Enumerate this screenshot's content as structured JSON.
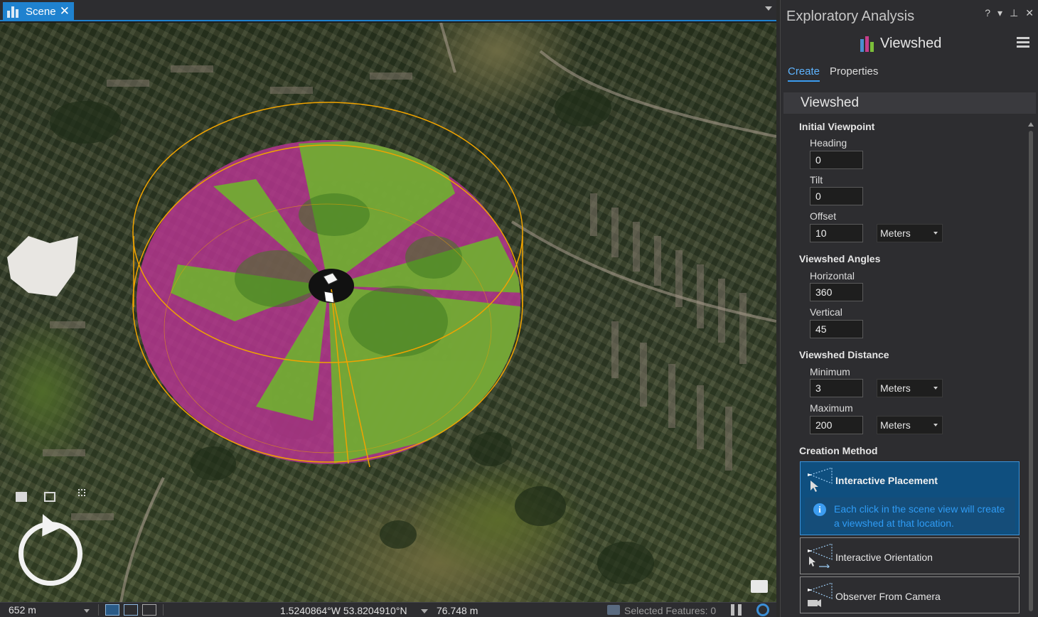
{
  "scene_tab": {
    "label": "Scene",
    "close": "✕"
  },
  "status_bar": {
    "scale": "652 m",
    "coordinates": "1.5240864°W 53.8204910°N",
    "elevation": "76.748 m",
    "selected_features": "Selected Features: 0"
  },
  "panel": {
    "title": "Exploratory Analysis",
    "controls": {
      "help": "?",
      "menu": "▾",
      "pin": "⊥",
      "close": "✕"
    },
    "tool_name": "Viewshed",
    "tabs": [
      {
        "label": "Create",
        "active": true
      },
      {
        "label": "Properties",
        "active": false
      }
    ],
    "section": "Viewshed",
    "initial_viewpoint": {
      "heading": "Initial Viewpoint",
      "heading_label": "Heading",
      "heading_value": "0",
      "tilt_label": "Tilt",
      "tilt_value": "0",
      "offset_label": "Offset",
      "offset_value": "10",
      "offset_unit": "Meters"
    },
    "angles": {
      "heading": "Viewshed Angles",
      "horizontal_label": "Horizontal",
      "horizontal_value": "360",
      "vertical_label": "Vertical",
      "vertical_value": "45"
    },
    "distance": {
      "heading": "Viewshed Distance",
      "minimum_label": "Minimum",
      "minimum_value": "3",
      "minimum_unit": "Meters",
      "maximum_label": "Maximum",
      "maximum_value": "200",
      "maximum_unit": "Meters"
    },
    "creation": {
      "heading": "Creation Method",
      "interactive_placement": "Interactive Placement",
      "placement_info": "Each click in the scene view will create a viewshed at that location.",
      "interactive_orientation": "Interactive Orientation",
      "observer_from_camera": "Observer From Camera"
    }
  },
  "colors": {
    "accent": "#1f82cf",
    "visible": "#7ec13a",
    "not_visible": "#b4358e",
    "boundary": "#f0a300"
  }
}
